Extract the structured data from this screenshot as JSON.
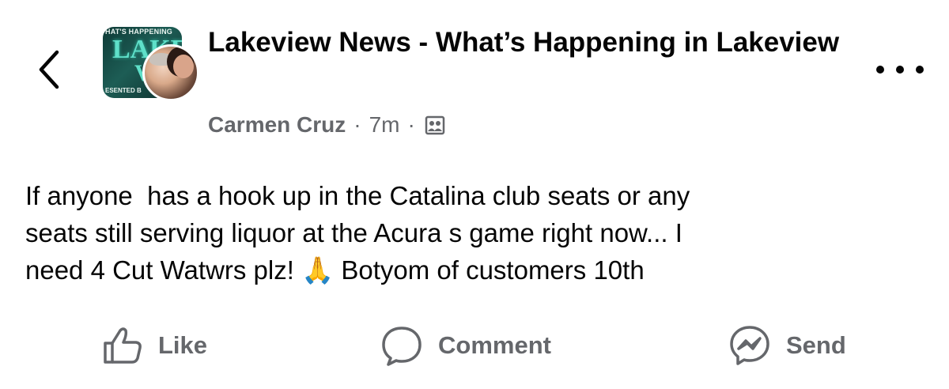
{
  "header": {
    "group_title": "Lakeview News - What’s Happening in Lakeview",
    "author": "Carmen Cruz",
    "separator": "·",
    "time": "7m",
    "audience_icon": "group-audience-icon",
    "back_icon": "chevron-left-icon",
    "more_icon": "more-dots-icon"
  },
  "group_avatar": {
    "text_top": "HAT'S HAPPENING",
    "text_mid": "LAKE",
    "text_mid2": "VI",
    "text_bottom": "ESENTED B"
  },
  "post": {
    "text": "If anyone  has a hook up in the Catalina club seats or any\nseats still serving liquor at the Acura s game right now... I\nneed 4 Cut Watwrs plz! 🙏 Botyom of customers 10th"
  },
  "actions": [
    {
      "label": "Like",
      "icon": "thumbs-up-icon"
    },
    {
      "label": "Comment",
      "icon": "comment-bubble-icon"
    },
    {
      "label": "Send",
      "icon": "messenger-icon"
    }
  ],
  "colors": {
    "text_primary": "#050505",
    "text_secondary": "#65676b",
    "background": "#ffffff"
  }
}
